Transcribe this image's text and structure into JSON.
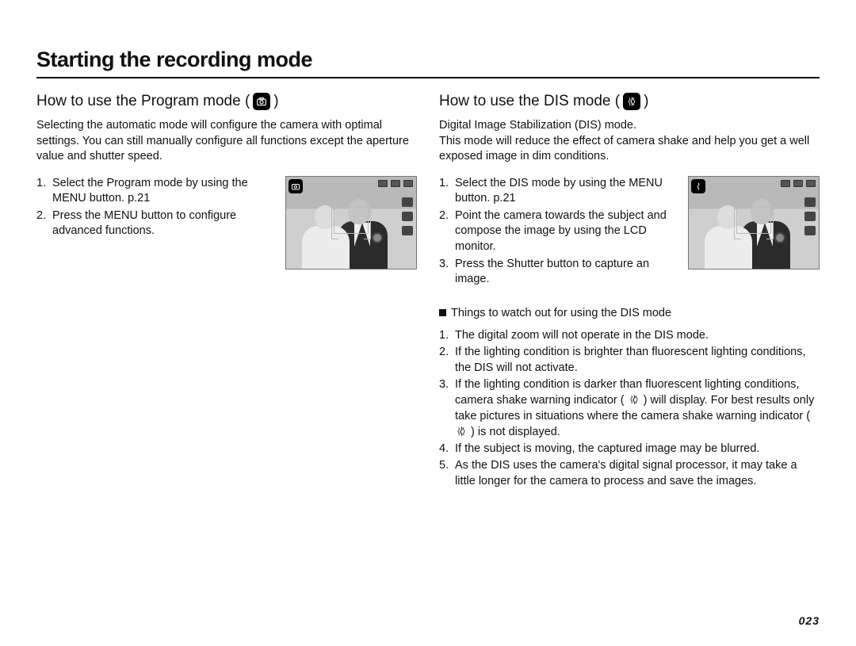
{
  "page_title": "Starting the recording mode",
  "page_number": "023",
  "left": {
    "heading_prefix": "How to use the Program mode (",
    "heading_suffix": " )",
    "mode_icon_name": "program-mode-icon",
    "intro": "Selecting the automatic mode will configure the camera with optimal settings. You can still manually configure all functions except the aperture value and shutter speed.",
    "steps": [
      {
        "n": "1.",
        "t": "Select the Program mode by using the MENU button. p.21"
      },
      {
        "n": "2.",
        "t": "Press the MENU button to configure advanced functions."
      }
    ]
  },
  "right": {
    "heading_prefix": "How to use the DIS mode (",
    "heading_suffix": " )",
    "mode_icon_name": "dis-mode-icon",
    "intro": "Digital Image Stabilization (DIS) mode.\nThis mode will reduce the effect of camera shake and help you get a well exposed image in dim conditions.",
    "steps": [
      {
        "n": "1.",
        "t": "Select the DIS mode by using the MENU button. p.21"
      },
      {
        "n": "2.",
        "t": "Point the camera towards the subject and compose the image by using the LCD monitor."
      },
      {
        "n": "3.",
        "t": "Press the Shutter button to capture an image."
      }
    ],
    "sub_heading": "Things to watch out for using the DIS mode",
    "notes": [
      {
        "n": "1.",
        "t": "The digital zoom will not operate in the DIS mode."
      },
      {
        "n": "2.",
        "t": "If the lighting condition is brighter than fluorescent lighting conditions, the DIS will not activate."
      },
      {
        "n": "3.",
        "t_a": "If the lighting condition is darker than fluorescent lighting conditions, camera shake warning indicator ( ",
        "t_b": " ) will display. For best results only take pictures in situations where the camera shake warning indicator ( ",
        "t_c": " ) is not displayed."
      },
      {
        "n": "4.",
        "t": "If the subject is moving, the captured image may be blurred."
      },
      {
        "n": "5.",
        "t": "As the DIS uses the camera's digital signal processor, it may take a little longer for the camera to process and save the images."
      }
    ]
  }
}
